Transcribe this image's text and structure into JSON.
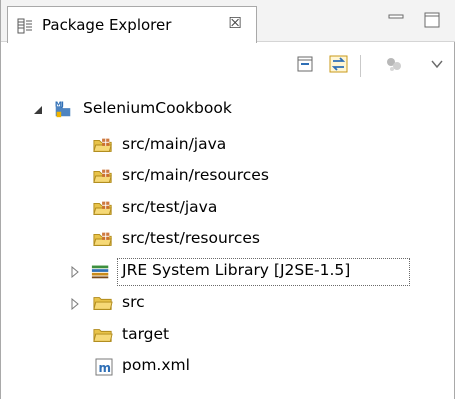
{
  "view": {
    "title": "Package Explorer",
    "close_symbol": "☒"
  },
  "tree": {
    "project": {
      "label": "SeleniumCookbook",
      "icon": "maven-project-icon",
      "expanded": true
    },
    "items": [
      {
        "label": "src/main/java",
        "icon": "source-folder-icon"
      },
      {
        "label": "src/main/resources",
        "icon": "source-folder-icon"
      },
      {
        "label": "src/test/java",
        "icon": "source-folder-icon"
      },
      {
        "label": "src/test/resources",
        "icon": "source-folder-icon"
      },
      {
        "label": "JRE System Library [J2SE-1.5]",
        "icon": "library-icon",
        "expandable": true
      },
      {
        "label": "src",
        "icon": "folder-icon",
        "expandable": true
      },
      {
        "label": "target",
        "icon": "folder-icon",
        "expandable": false
      },
      {
        "label": "pom.xml",
        "icon": "maven-file-icon",
        "expandable": false
      }
    ]
  },
  "colors": {
    "header_bg": "#f3f3f3",
    "folder_yellow": "#e8c34a",
    "library_green": "#3d8f3d",
    "link_blue": "#2f6fb6"
  }
}
